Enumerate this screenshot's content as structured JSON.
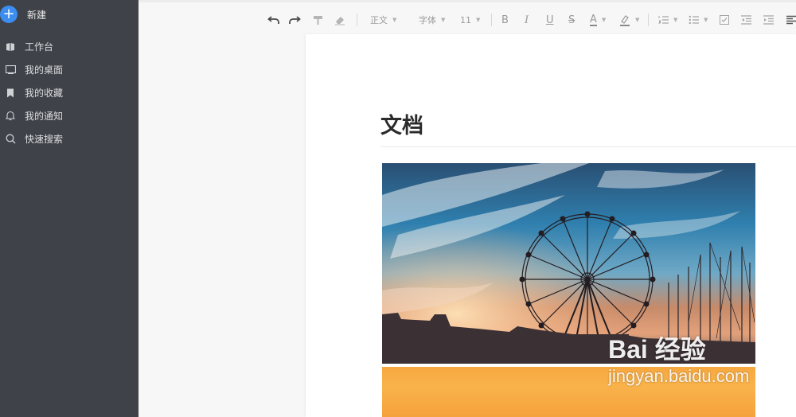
{
  "sidebar": {
    "new_label": "新建",
    "items": [
      {
        "label": "工作台",
        "icon": "workspace-icon"
      },
      {
        "label": "我的桌面",
        "icon": "desktop-icon"
      },
      {
        "label": "我的收藏",
        "icon": "bookmark-icon"
      },
      {
        "label": "我的通知",
        "icon": "bell-icon"
      },
      {
        "label": "快速搜索",
        "icon": "search-icon"
      }
    ]
  },
  "toolbar": {
    "paragraph_style": "正文",
    "font_family": "字体",
    "font_size": "11",
    "bold": "B",
    "italic": "I",
    "underline": "U",
    "strikethrough": "S",
    "font_color": "A"
  },
  "document": {
    "title": "文档"
  },
  "watermark": {
    "main": "Bai 经验",
    "sub": "jingyan.baidu.com"
  },
  "colors": {
    "sidebar_bg": "#3f4248",
    "accent": "#3b8ef0"
  }
}
